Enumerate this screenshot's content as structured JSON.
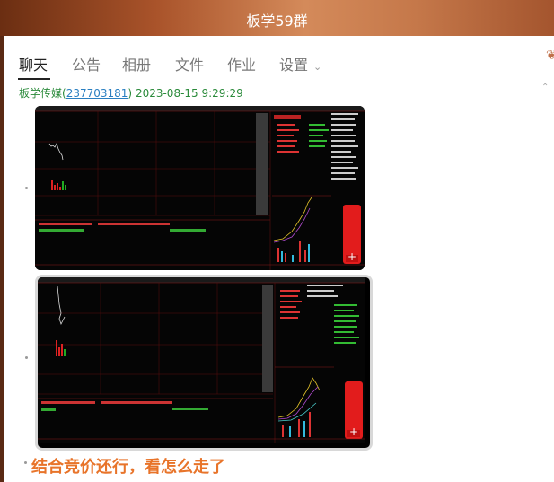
{
  "window": {
    "title": "板学59群"
  },
  "tabs": [
    {
      "label": "聊天",
      "active": true
    },
    {
      "label": "公告"
    },
    {
      "label": "相册"
    },
    {
      "label": "文件"
    },
    {
      "label": "作业"
    },
    {
      "label": "设置"
    }
  ],
  "message": {
    "sender_name": "板学传媒",
    "sender_id": "237703181",
    "paren_open": "(",
    "paren_close": ")",
    "timestamp": "2023-08-15 9:29:29",
    "caption": "结合竞价还行，看怎么走了"
  },
  "icons": {
    "settings_dropdown": "chevron-down-icon",
    "collapse": "chevron-up-icon",
    "edge": "leaf-icon"
  },
  "colors": {
    "accent_orange": "#e8742a",
    "sender_green": "#2a8a3a",
    "link_blue": "#2a7fc1"
  }
}
